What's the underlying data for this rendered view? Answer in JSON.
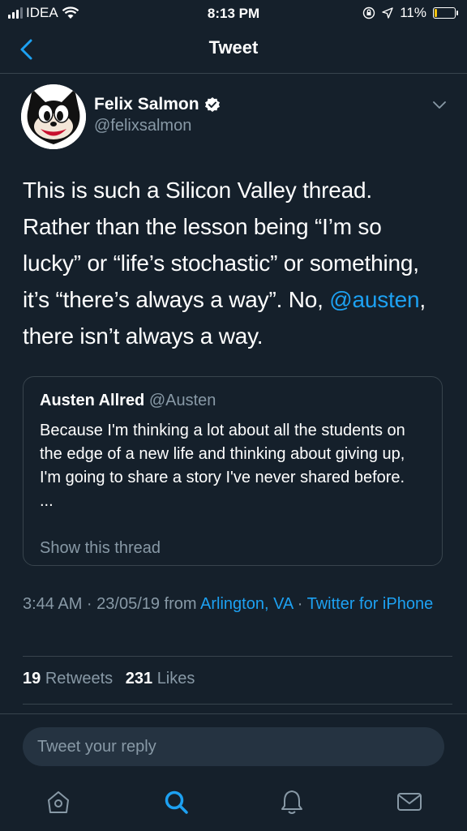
{
  "status": {
    "carrier": "IDEA",
    "time": "8:13 PM",
    "battery": "11%",
    "battery_level": 0.11
  },
  "nav": {
    "title": "Tweet"
  },
  "author": {
    "name": "Felix Salmon",
    "handle": "@felixsalmon"
  },
  "tweet": {
    "text_1": "This is such a Silicon Valley thread. Rather than the lesson being “I’m so lucky” or “life’s stochastic” or something, it’s “there’s always a way”. No, ",
    "mention": "@austen",
    "text_2": ", there isn’t always a way."
  },
  "quote": {
    "name": "Austen Allred",
    "handle": "@Austen",
    "text": "Because I'm thinking a lot about all the students on the edge of a new life and thinking about giving up, I'm going to share a story I've never shared before.",
    "ellipsis": "...",
    "show_thread": "Show this thread"
  },
  "meta": {
    "time_date": "3:44 AM · 23/05/19 from ",
    "location": "Arlington, VA",
    "sep": " · ",
    "source": "Twitter for iPhone"
  },
  "stats": {
    "retweets_count": "19",
    "retweets_label": "Retweets",
    "likes_count": "231",
    "likes_label": "Likes"
  },
  "reply": {
    "placeholder": "Tweet your reply"
  },
  "tabs": [
    "home-icon",
    "search-icon",
    "notifications-icon",
    "messages-icon"
  ],
  "colors": {
    "background": "#15202b",
    "accent": "#1da1f2",
    "secondary_text": "#8899a6",
    "border": "#38444d"
  }
}
